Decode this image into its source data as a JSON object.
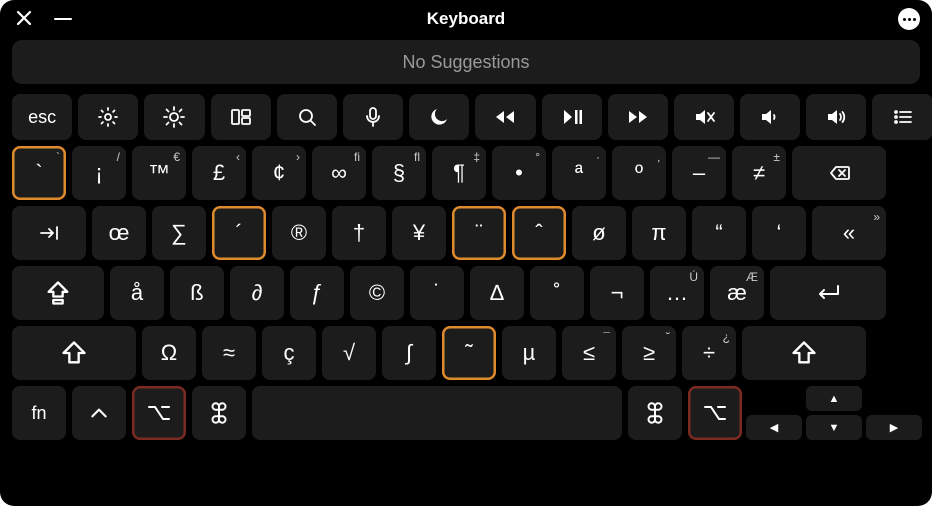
{
  "window": {
    "title": "Keyboard"
  },
  "suggestions": {
    "text": "No Suggestions"
  },
  "func_row": [
    {
      "name": "escape",
      "label": "esc"
    },
    {
      "name": "brightness-down",
      "icon": "brightness-down"
    },
    {
      "name": "brightness-up",
      "icon": "brightness-up"
    },
    {
      "name": "mission-control",
      "icon": "mission-control"
    },
    {
      "name": "spotlight",
      "icon": "search"
    },
    {
      "name": "dictation",
      "icon": "mic"
    },
    {
      "name": "do-not-disturb",
      "icon": "moon"
    },
    {
      "name": "rewind",
      "icon": "rewind"
    },
    {
      "name": "play-pause",
      "icon": "play-pause"
    },
    {
      "name": "fast-forward",
      "icon": "ffwd"
    },
    {
      "name": "mute",
      "icon": "mute"
    },
    {
      "name": "volume-down",
      "icon": "vol-down"
    },
    {
      "name": "volume-up",
      "icon": "vol-up"
    },
    {
      "name": "list",
      "icon": "list"
    }
  ],
  "row1": [
    {
      "name": "grave",
      "label": "`",
      "sub": "`",
      "hl": "orange"
    },
    {
      "name": "key-1",
      "label": "¡",
      "sub": "/"
    },
    {
      "name": "key-2",
      "label": "™",
      "sub": "€"
    },
    {
      "name": "key-3",
      "label": "£",
      "sub": "‹"
    },
    {
      "name": "key-4",
      "label": "¢",
      "sub": "›"
    },
    {
      "name": "key-5",
      "label": "∞",
      "sub": "fi"
    },
    {
      "name": "key-6",
      "label": "§",
      "sub": "fl"
    },
    {
      "name": "key-7",
      "label": "¶",
      "sub": "‡"
    },
    {
      "name": "key-8",
      "label": "•",
      "sub": "°"
    },
    {
      "name": "key-9",
      "label": "ª",
      "sub": "·"
    },
    {
      "name": "key-0",
      "label": "º",
      "sub": "‚"
    },
    {
      "name": "key-minus",
      "label": "–",
      "sub": "—"
    },
    {
      "name": "key-equal",
      "label": "≠",
      "sub": "±"
    },
    {
      "name": "delete",
      "icon": "delete",
      "cls": "delete"
    }
  ],
  "row2": [
    {
      "name": "tab",
      "icon": "tab",
      "cls": "tab"
    },
    {
      "name": "key-q",
      "label": "œ"
    },
    {
      "name": "key-w",
      "label": "∑"
    },
    {
      "name": "key-e",
      "label": "´",
      "hl": "orange"
    },
    {
      "name": "key-r",
      "label": "®"
    },
    {
      "name": "key-t",
      "label": "†"
    },
    {
      "name": "key-y",
      "label": "¥"
    },
    {
      "name": "key-u",
      "label": "¨",
      "hl": "orange"
    },
    {
      "name": "key-i",
      "label": "ˆ",
      "hl": "orange"
    },
    {
      "name": "key-o",
      "label": "ø"
    },
    {
      "name": "key-p",
      "label": "π"
    },
    {
      "name": "key-lbracket",
      "label": "“"
    },
    {
      "name": "key-rbracket",
      "label": "‘"
    },
    {
      "name": "key-backslash",
      "label": "«",
      "sub": "»",
      "cls": "last"
    }
  ],
  "row3": [
    {
      "name": "caps-lock",
      "icon": "caps",
      "cls": "caps"
    },
    {
      "name": "key-a",
      "label": "å"
    },
    {
      "name": "key-s",
      "label": "ß"
    },
    {
      "name": "key-d",
      "label": "∂"
    },
    {
      "name": "key-f",
      "label": "ƒ"
    },
    {
      "name": "key-g",
      "label": "©"
    },
    {
      "name": "key-h",
      "label": "˙"
    },
    {
      "name": "key-j",
      "label": "∆"
    },
    {
      "name": "key-k",
      "label": "˚"
    },
    {
      "name": "key-l",
      "label": "¬"
    },
    {
      "name": "key-semicolon",
      "label": "…",
      "sub": "Ú"
    },
    {
      "name": "key-quote",
      "label": "æ",
      "sub": "Æ"
    },
    {
      "name": "return",
      "icon": "return",
      "cls": "return"
    }
  ],
  "row4": [
    {
      "name": "shift-left",
      "icon": "shift",
      "cls": "shift"
    },
    {
      "name": "key-z",
      "label": "Ω"
    },
    {
      "name": "key-x",
      "label": "≈"
    },
    {
      "name": "key-c",
      "label": "ç"
    },
    {
      "name": "key-v",
      "label": "√"
    },
    {
      "name": "key-b",
      "label": "∫"
    },
    {
      "name": "key-n",
      "label": "˜",
      "hl": "orange"
    },
    {
      "name": "key-m",
      "label": "µ"
    },
    {
      "name": "key-comma",
      "label": "≤",
      "sub": "¯"
    },
    {
      "name": "key-period",
      "label": "≥",
      "sub": "˘"
    },
    {
      "name": "key-slash",
      "label": "÷",
      "sub": "¿"
    },
    {
      "name": "shift-right",
      "icon": "shift",
      "cls": "shift"
    }
  ],
  "row5": [
    {
      "name": "fn",
      "label": "fn"
    },
    {
      "name": "control",
      "icon": "control"
    },
    {
      "name": "option-left",
      "icon": "option",
      "hl": "red"
    },
    {
      "name": "command-left",
      "icon": "command"
    },
    {
      "name": "space",
      "cls": "space",
      "label": ""
    },
    {
      "name": "command-right",
      "icon": "command"
    },
    {
      "name": "option-right",
      "icon": "option",
      "hl": "red"
    }
  ],
  "arrows": {
    "up": "▲",
    "left": "◀",
    "down": "▼",
    "right": "▶"
  }
}
